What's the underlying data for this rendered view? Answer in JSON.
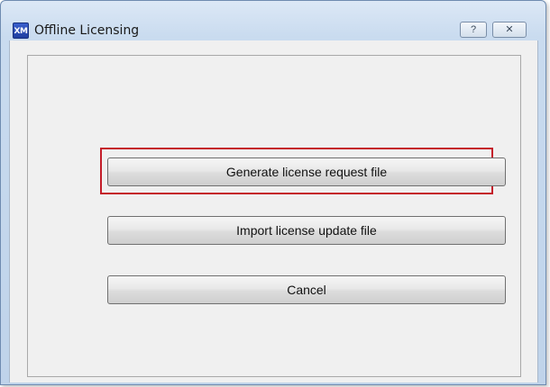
{
  "window": {
    "title": "Offline Licensing",
    "icon_text": "XM",
    "icon": "xm-app-icon",
    "caption_buttons": {
      "help": {
        "label": "?",
        "icon": "help-icon"
      },
      "close": {
        "label": "✕",
        "icon": "close-icon"
      }
    }
  },
  "actions": {
    "generate_label": "Generate license request file",
    "import_label": "Import license update file",
    "cancel_label": "Cancel"
  },
  "colors": {
    "highlight_border": "#c41e2a",
    "title_bar": "#c9dbef",
    "client_background": "#f0f0f0"
  }
}
